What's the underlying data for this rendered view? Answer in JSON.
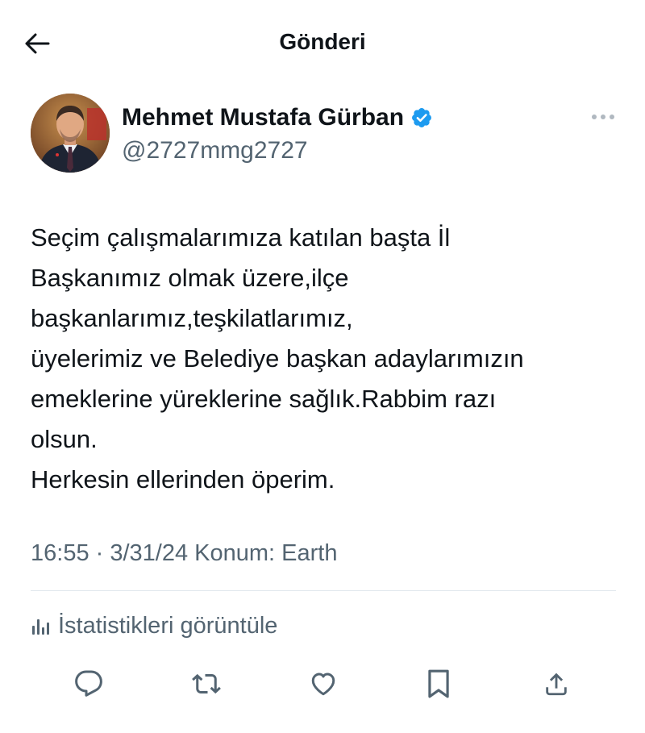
{
  "header": {
    "title": "Gönderi",
    "back_icon": "arrow-left-icon"
  },
  "author": {
    "name": "Mehmet Mustafa Gürban",
    "handle": "@2727mmg2727",
    "verified": true,
    "verified_color": "#1d9bf0",
    "more_icon": "ellipsis-icon"
  },
  "tweet": {
    "lines": [
      "Seçim çalışmalarımıza katılan başta İl",
      "Başkanımız olmak üzere,ilçe",
      "başkanlarımız,teşkilatlarımız,",
      "üyelerimiz ve Belediye başkan adaylarımızın",
      "emeklerine yüreklerine sağlık.Rabbim razı",
      "olsun.",
      "Herkesin ellerinden öperim."
    ],
    "meta": "16:55 · 3/31/24 Konum: Earth"
  },
  "stats": {
    "label": "İstatistikleri görüntüle",
    "icon": "bar-chart-icon"
  },
  "actions": {
    "reply_icon": "reply-icon",
    "retweet_icon": "retweet-icon",
    "like_icon": "heart-icon",
    "bookmark_icon": "bookmark-icon",
    "share_icon": "share-icon"
  },
  "colors": {
    "text_primary": "#0f1419",
    "text_secondary": "#536471",
    "divider": "#e1e8ed",
    "icon": "#536471"
  }
}
